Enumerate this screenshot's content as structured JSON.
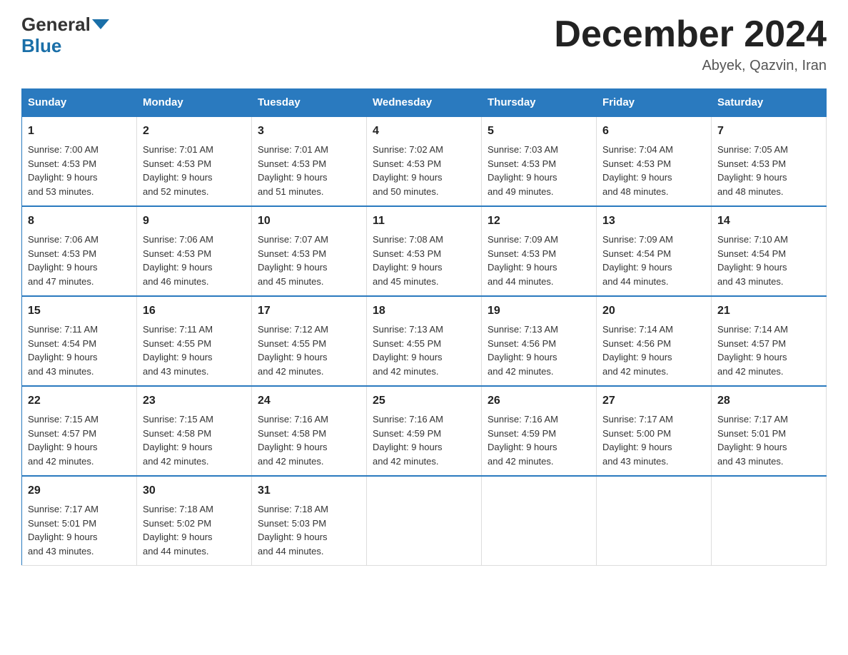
{
  "header": {
    "logo_line1": "General",
    "logo_line2": "Blue",
    "month_title": "December 2024",
    "subtitle": "Abyek, Qazvin, Iran"
  },
  "days_of_week": [
    "Sunday",
    "Monday",
    "Tuesday",
    "Wednesday",
    "Thursday",
    "Friday",
    "Saturday"
  ],
  "weeks": [
    [
      {
        "day": "1",
        "sunrise": "7:00 AM",
        "sunset": "4:53 PM",
        "daylight": "9 hours and 53 minutes."
      },
      {
        "day": "2",
        "sunrise": "7:01 AM",
        "sunset": "4:53 PM",
        "daylight": "9 hours and 52 minutes."
      },
      {
        "day": "3",
        "sunrise": "7:01 AM",
        "sunset": "4:53 PM",
        "daylight": "9 hours and 51 minutes."
      },
      {
        "day": "4",
        "sunrise": "7:02 AM",
        "sunset": "4:53 PM",
        "daylight": "9 hours and 50 minutes."
      },
      {
        "day": "5",
        "sunrise": "7:03 AM",
        "sunset": "4:53 PM",
        "daylight": "9 hours and 49 minutes."
      },
      {
        "day": "6",
        "sunrise": "7:04 AM",
        "sunset": "4:53 PM",
        "daylight": "9 hours and 48 minutes."
      },
      {
        "day": "7",
        "sunrise": "7:05 AM",
        "sunset": "4:53 PM",
        "daylight": "9 hours and 48 minutes."
      }
    ],
    [
      {
        "day": "8",
        "sunrise": "7:06 AM",
        "sunset": "4:53 PM",
        "daylight": "9 hours and 47 minutes."
      },
      {
        "day": "9",
        "sunrise": "7:06 AM",
        "sunset": "4:53 PM",
        "daylight": "9 hours and 46 minutes."
      },
      {
        "day": "10",
        "sunrise": "7:07 AM",
        "sunset": "4:53 PM",
        "daylight": "9 hours and 45 minutes."
      },
      {
        "day": "11",
        "sunrise": "7:08 AM",
        "sunset": "4:53 PM",
        "daylight": "9 hours and 45 minutes."
      },
      {
        "day": "12",
        "sunrise": "7:09 AM",
        "sunset": "4:53 PM",
        "daylight": "9 hours and 44 minutes."
      },
      {
        "day": "13",
        "sunrise": "7:09 AM",
        "sunset": "4:54 PM",
        "daylight": "9 hours and 44 minutes."
      },
      {
        "day": "14",
        "sunrise": "7:10 AM",
        "sunset": "4:54 PM",
        "daylight": "9 hours and 43 minutes."
      }
    ],
    [
      {
        "day": "15",
        "sunrise": "7:11 AM",
        "sunset": "4:54 PM",
        "daylight": "9 hours and 43 minutes."
      },
      {
        "day": "16",
        "sunrise": "7:11 AM",
        "sunset": "4:55 PM",
        "daylight": "9 hours and 43 minutes."
      },
      {
        "day": "17",
        "sunrise": "7:12 AM",
        "sunset": "4:55 PM",
        "daylight": "9 hours and 42 minutes."
      },
      {
        "day": "18",
        "sunrise": "7:13 AM",
        "sunset": "4:55 PM",
        "daylight": "9 hours and 42 minutes."
      },
      {
        "day": "19",
        "sunrise": "7:13 AM",
        "sunset": "4:56 PM",
        "daylight": "9 hours and 42 minutes."
      },
      {
        "day": "20",
        "sunrise": "7:14 AM",
        "sunset": "4:56 PM",
        "daylight": "9 hours and 42 minutes."
      },
      {
        "day": "21",
        "sunrise": "7:14 AM",
        "sunset": "4:57 PM",
        "daylight": "9 hours and 42 minutes."
      }
    ],
    [
      {
        "day": "22",
        "sunrise": "7:15 AM",
        "sunset": "4:57 PM",
        "daylight": "9 hours and 42 minutes."
      },
      {
        "day": "23",
        "sunrise": "7:15 AM",
        "sunset": "4:58 PM",
        "daylight": "9 hours and 42 minutes."
      },
      {
        "day": "24",
        "sunrise": "7:16 AM",
        "sunset": "4:58 PM",
        "daylight": "9 hours and 42 minutes."
      },
      {
        "day": "25",
        "sunrise": "7:16 AM",
        "sunset": "4:59 PM",
        "daylight": "9 hours and 42 minutes."
      },
      {
        "day": "26",
        "sunrise": "7:16 AM",
        "sunset": "4:59 PM",
        "daylight": "9 hours and 42 minutes."
      },
      {
        "day": "27",
        "sunrise": "7:17 AM",
        "sunset": "5:00 PM",
        "daylight": "9 hours and 43 minutes."
      },
      {
        "day": "28",
        "sunrise": "7:17 AM",
        "sunset": "5:01 PM",
        "daylight": "9 hours and 43 minutes."
      }
    ],
    [
      {
        "day": "29",
        "sunrise": "7:17 AM",
        "sunset": "5:01 PM",
        "daylight": "9 hours and 43 minutes."
      },
      {
        "day": "30",
        "sunrise": "7:18 AM",
        "sunset": "5:02 PM",
        "daylight": "9 hours and 44 minutes."
      },
      {
        "day": "31",
        "sunrise": "7:18 AM",
        "sunset": "5:03 PM",
        "daylight": "9 hours and 44 minutes."
      },
      null,
      null,
      null,
      null
    ]
  ],
  "labels": {
    "sunrise": "Sunrise:",
    "sunset": "Sunset:",
    "daylight": "Daylight:"
  }
}
